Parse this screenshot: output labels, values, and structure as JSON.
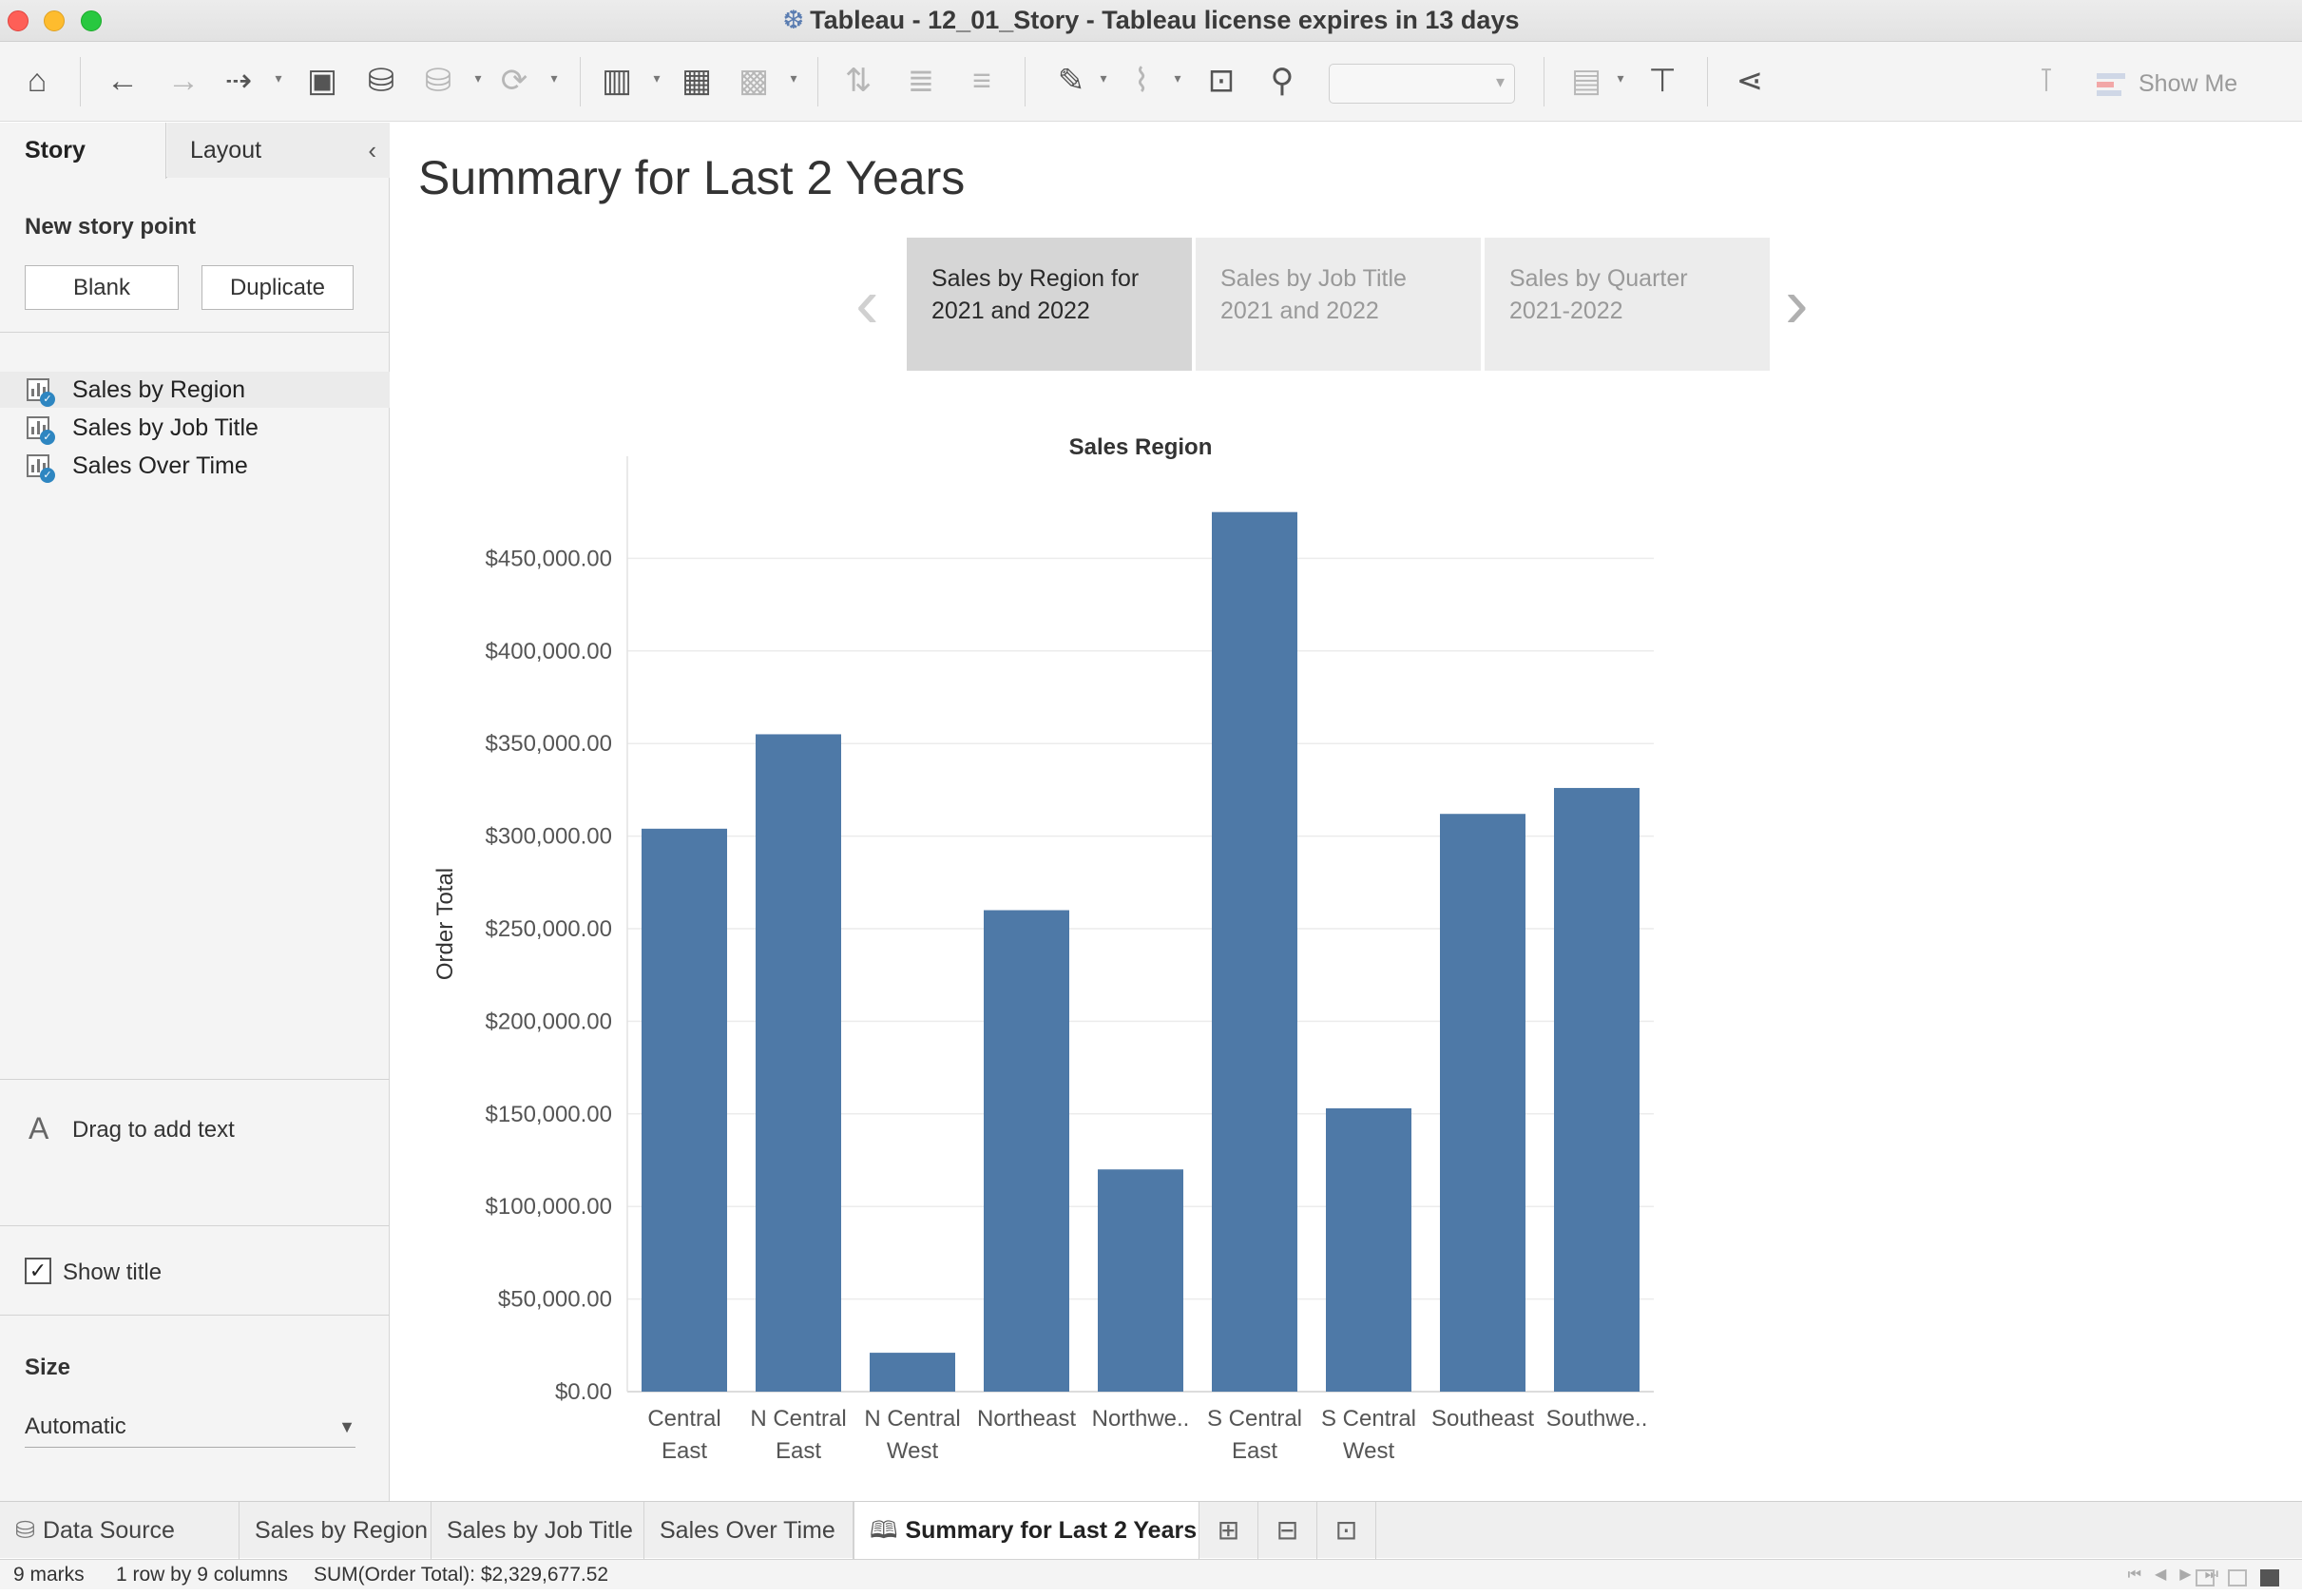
{
  "window": {
    "title": "Tableau - 12_01_Story - Tableau license expires in 13 days"
  },
  "toolbar": {
    "show_me_label": "Show Me",
    "icons": [
      "home-icon",
      "back-icon",
      "forward-icon",
      "redo-icon",
      "save-icon",
      "new-datasource-icon",
      "pause-datasource-icon",
      "refresh-icon",
      "new-sheet-icon",
      "duplicate-sheet-icon",
      "clear-sheet-icon",
      "swap-icon",
      "sort-ascending-icon",
      "sort-descending-icon",
      "highlight-icon",
      "group-icon",
      "labels-icon",
      "fix-axes-icon",
      "fit-icon",
      "presentation-icon",
      "share-icon",
      "tooltip-icon"
    ]
  },
  "left_pane": {
    "tabs": {
      "story": "Story",
      "layout": "Layout"
    },
    "new_story_point_label": "New story point",
    "blank_button": "Blank",
    "duplicate_button": "Duplicate",
    "sheets": [
      {
        "label": "Sales by Region",
        "selected": true
      },
      {
        "label": "Sales by Job Title",
        "selected": false
      },
      {
        "label": "Sales Over Time",
        "selected": false
      }
    ],
    "drag_text_label": "Drag to add text",
    "show_title_label": "Show title",
    "show_title_checked": true,
    "size_label": "Size",
    "size_value": "Automatic"
  },
  "story": {
    "title": "Summary for Last 2 Years",
    "points": [
      {
        "line1": "Sales by Region for",
        "line2": "2021 and 2022",
        "active": true
      },
      {
        "line1": "Sales by Job Title",
        "line2": "2021 and 2022",
        "active": false
      },
      {
        "line1": "Sales by Quarter",
        "line2": "2021-2022",
        "active": false
      }
    ]
  },
  "chart_data": {
    "type": "bar",
    "title": "Sales Region",
    "xlabel": "",
    "ylabel": "Order Total",
    "categories": [
      [
        "Central",
        "East"
      ],
      [
        "N Central",
        "East"
      ],
      [
        "N Central",
        "West"
      ],
      [
        "Northeast"
      ],
      [
        "Northwe.."
      ],
      [
        "S Central",
        "East"
      ],
      [
        "S Central",
        "West"
      ],
      [
        "Southeast"
      ],
      [
        "Southwe.."
      ]
    ],
    "values": [
      304000,
      355000,
      21000,
      260000,
      120000,
      475000,
      153000,
      312000,
      326000
    ],
    "ylim": [
      0,
      500000
    ],
    "yticks": [
      0,
      50000,
      100000,
      150000,
      200000,
      250000,
      300000,
      350000,
      400000,
      450000
    ],
    "ytick_labels": [
      "$0.00",
      "$50,000.00",
      "$100,000.00",
      "$150,000.00",
      "$200,000.00",
      "$250,000.00",
      "$300,000.00",
      "$350,000.00",
      "$400,000.00",
      "$450,000.00"
    ],
    "bar_color": "#4e79a7",
    "grid": true
  },
  "bottom_tabs": {
    "data_source": "Data Source",
    "sheets": [
      "Sales by Region",
      "Sales by Job Title",
      "Sales Over Time"
    ],
    "active": "Summary for Last 2 Years"
  },
  "status": {
    "marks": "9 marks",
    "rows_cols": "1 row by 9 columns",
    "sum": "SUM(Order Total): $2,329,677.52"
  }
}
